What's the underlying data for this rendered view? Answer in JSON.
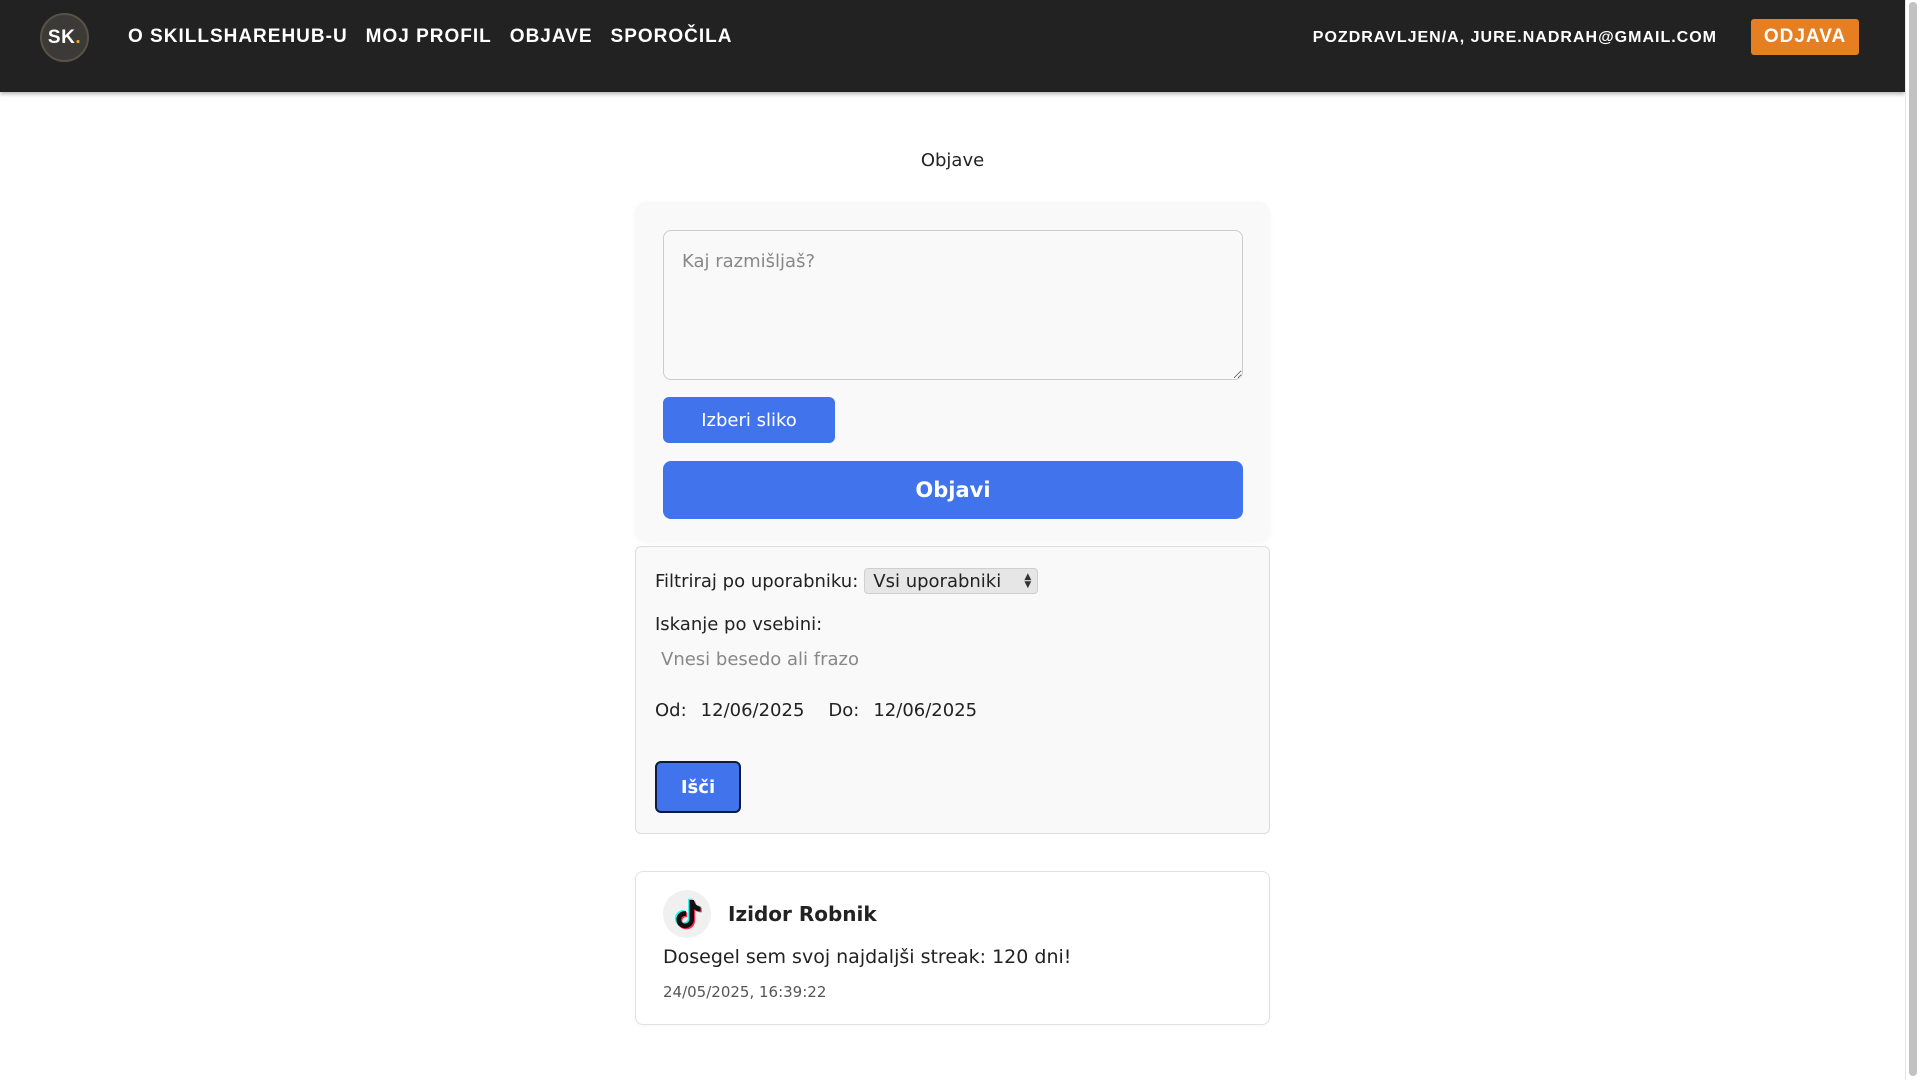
{
  "header": {
    "logo_text": "SK",
    "logo_dot": ".",
    "nav": [
      {
        "label": "O SkillShareHub-u"
      },
      {
        "label": "Moj profil"
      },
      {
        "label": "Objave"
      },
      {
        "label": "Sporočila"
      }
    ],
    "greeting": "Pozdravljen/a, jure.nadrah@gmail.com",
    "logout_label": "Odjava"
  },
  "page": {
    "title": "Objave"
  },
  "composer": {
    "placeholder": "Kaj razmišljaš?",
    "value": "",
    "image_button": "Izberi sliko",
    "post_button": "Objavi"
  },
  "filter": {
    "user_label": "Filtriraj po uporabniku:",
    "user_selected": "Vsi uporabniki",
    "content_label": "Iskanje po vsebini:",
    "content_placeholder": "Vnesi besedo ali frazo",
    "from_label": "Od:",
    "from_value": "12/06/2025",
    "to_label": "Do:",
    "to_value": "12/06/2025",
    "search_button": "Išči"
  },
  "posts": [
    {
      "author": "Izidor Robnik",
      "avatar_icon": "tiktok-icon",
      "text": "Dosegel sem svoj najdaljši streak: 120 dni!",
      "timestamp": "24/05/2025, 16:39:22"
    }
  ],
  "colors": {
    "header_bg": "#222222",
    "accent_orange": "#e67e22",
    "primary_blue": "#4174ec",
    "logo_dot": "#f5a623"
  }
}
